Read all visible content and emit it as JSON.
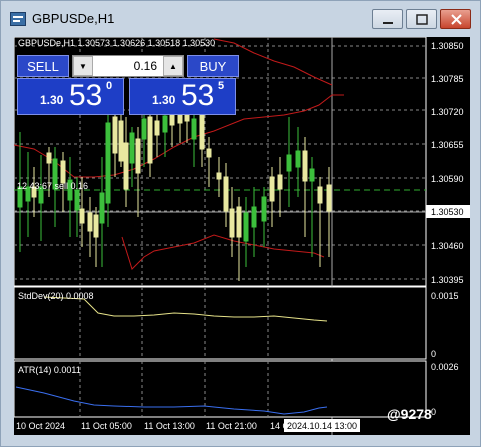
{
  "window": {
    "title": "GBPUSDe,H1"
  },
  "chart": {
    "header": "GBPUSDe,H1  1.30573 1.30626 1.30518 1.30530",
    "order_line_label": "12 43:67  sell 0.16",
    "price_axis": [
      "1.30850",
      "1.30785",
      "1.30720",
      "1.30655",
      "1.30590",
      "1.30530",
      "1.30460",
      "1.30395"
    ],
    "current_price": "1.30530",
    "stddev_label": "StdDev(20) 0.0008",
    "stddev_axis": [
      "0.0015",
      "0"
    ],
    "atr_label": "ATR(14) 0.0011",
    "atr_axis": [
      "0.0026",
      "0"
    ],
    "time_axis": [
      "10 Oct 2024",
      "11 Oct 05:00",
      "11 Oct 13:00",
      "11 Oct 21:00",
      "14 Oct"
    ],
    "time_highlight": "2024.10.14 13:00"
  },
  "trade_panel": {
    "sell_label": "SELL",
    "buy_label": "BUY",
    "lot_value": "0.16",
    "sell_price_small": "1.30",
    "sell_price_big": "53",
    "sell_price_sup": "0",
    "buy_price_small": "1.30",
    "buy_price_big": "53",
    "buy_price_sup": "5"
  },
  "colors": {
    "up_candle": "#3cbf3c",
    "down_candle": "#e8e8a0",
    "bands": "#c21a1a",
    "stddev_line": "#e7e38a",
    "atr_line": "#3a6ff0",
    "panel_blue": "#1e3ec6"
  },
  "watermark": "@9278"
}
